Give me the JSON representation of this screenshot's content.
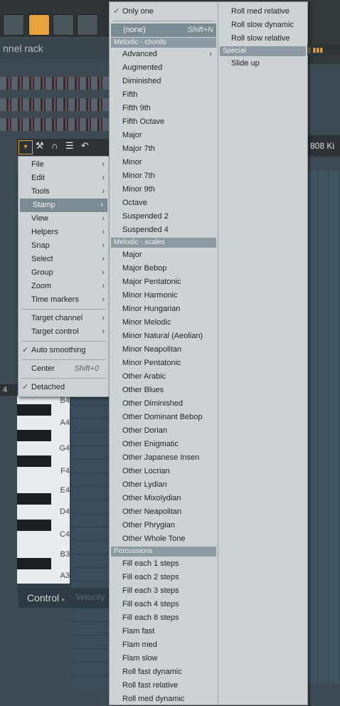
{
  "background": {
    "rack_title": "nnel rack",
    "channel_name": "808 Ki",
    "control_label": "Control",
    "velocity_label": "Velocity",
    "key_labels": [
      "B4",
      "A4",
      "G4",
      "F4",
      "E4",
      "D4",
      "C4",
      "B3",
      "A3"
    ],
    "octave_number": "4"
  },
  "main_menu": {
    "items": [
      {
        "label": "File",
        "submenu": true
      },
      {
        "label": "Edit",
        "submenu": true
      },
      {
        "label": "Tools",
        "submenu": true
      },
      {
        "label": "Stamp",
        "submenu": true,
        "highlighted": true
      },
      {
        "label": "View",
        "submenu": true
      },
      {
        "label": "Helpers",
        "submenu": true
      },
      {
        "label": "Snap",
        "submenu": true
      },
      {
        "label": "Select",
        "submenu": true
      },
      {
        "label": "Group",
        "submenu": true
      },
      {
        "label": "Zoom",
        "submenu": true
      },
      {
        "label": "Time markers",
        "submenu": true
      },
      {
        "label": "Target channel",
        "submenu": true
      },
      {
        "label": "Target control",
        "submenu": true
      },
      {
        "label": "Auto smoothing",
        "checked": true
      },
      {
        "label": "Center",
        "shortcut": "Shift+0"
      },
      {
        "label": "Detached",
        "checked": true
      }
    ]
  },
  "stamp_menu": {
    "only_one": "Only one",
    "none": {
      "label": "(none)",
      "shortcut": "Shift+N"
    },
    "chords_header": "Melodic - chords",
    "chords": [
      "Advanced",
      "Augmented",
      "Diminished",
      "Fifth",
      "Fifth 9th",
      "Fifth Octave",
      "Major",
      "Major 7th",
      "Minor",
      "Minor 7th",
      "Minor 9th",
      "Octave",
      "Suspended 2",
      "Suspended 4"
    ],
    "scales_header": "Melodic - scales",
    "scales": [
      "Major",
      "Major Bebop",
      "Major Pentatonic",
      "Minor Harmonic",
      "Minor Hungarian",
      "Minor Melodic",
      "Minor Natural (Aeolian)",
      "Minor Neapolitan",
      "Minor Pentatonic",
      "Other Arabic",
      "Other Blues",
      "Other Diminished",
      "Other Dominant Bebop",
      "Other Dorian",
      "Other Enigmatic",
      "Other Japanese Insen",
      "Other Locrian",
      "Other Lydian",
      "Other Mixolydian",
      "Other Neapolitan",
      "Other Phrygian",
      "Other Whole Tone"
    ],
    "perc_header": "Percussions",
    "percussions": [
      "Fill each 1 steps",
      "Fill each 2 steps",
      "Fill each 3 steps",
      "Fill each 4 steps",
      "Fill each 8 steps",
      "Flam fast",
      "Flam med",
      "Flam slow",
      "Roll fast dynamic",
      "Roll fast relative",
      "Roll med dynamic"
    ],
    "col2_top": [
      "Roll med relative",
      "Roll slow dynamic",
      "Roll slow relative"
    ],
    "special_header": "Special",
    "special": [
      "Slide up"
    ]
  }
}
